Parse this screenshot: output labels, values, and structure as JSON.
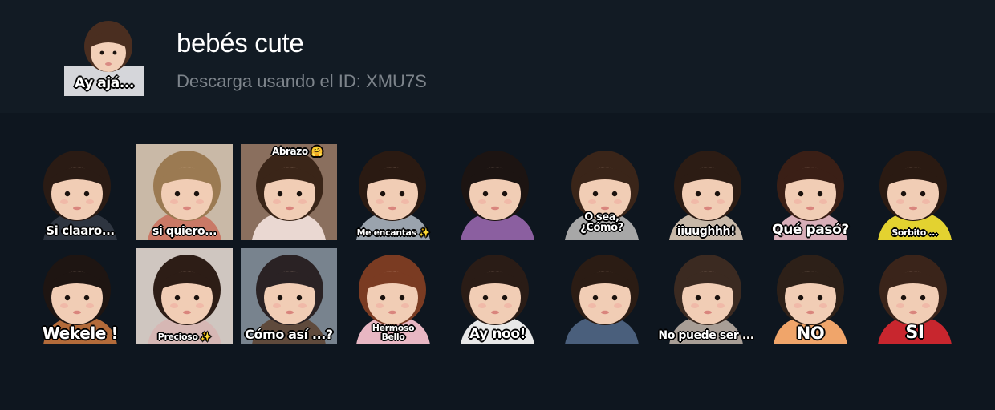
{
  "pack": {
    "title": "bebés cute",
    "subtitle": "Descarga usando el ID: XMU7S",
    "cover_caption": "Ay ajá...",
    "cover_bg": "#d9d9dc"
  },
  "stickers": [
    {
      "caption": "Si claaro...",
      "bg": "#0e161f",
      "hair": "#2a1b14",
      "shirt": "#2e3540"
    },
    {
      "caption": "si quiero...",
      "bg": "#c9b9a7",
      "hair": "#9b7a52",
      "shirt": "#c97966"
    },
    {
      "caption": "Abrazo 🤗",
      "bg": "#8a6f5e",
      "hair": "#3a2518",
      "shirt": "#ead8d2"
    },
    {
      "caption": "Me encantas ✨",
      "bg": "#0e161f",
      "hair": "#2a1a12",
      "shirt": "#9aa3ad"
    },
    {
      "caption": "",
      "bg": "#0e161f",
      "hair": "#1c1412",
      "shirt": "#8b5fa0"
    },
    {
      "caption": "O sea,\n¿Cómo?",
      "bg": "#0e161f",
      "hair": "#3a2519",
      "shirt": "#a7a7a7"
    },
    {
      "caption": "iiuughhh!",
      "bg": "#0e161f",
      "hair": "#2c1c14",
      "shirt": "#c7b8a8"
    },
    {
      "caption": "Qué pasó?",
      "bg": "#0e161f",
      "hair": "#3a1f16",
      "shirt": "#d8aeb8"
    },
    {
      "caption": "Sorbito ...",
      "bg": "#0e161f",
      "hair": "#2a1a12",
      "shirt": "#e3d230"
    },
    {
      "caption": "Wekele !",
      "bg": "#0e161f",
      "hair": "#1e1512",
      "shirt": "#b36b3a"
    },
    {
      "caption": "Precioso ✨",
      "bg": "#cfc6c0",
      "hair": "#2d1d16",
      "shirt": "#d6b7b4"
    },
    {
      "caption": "Cómo así ...?",
      "bg": "#78838e",
      "hair": "#2a2224",
      "shirt": "#5f4a3c"
    },
    {
      "caption": "Hermoso\nBello",
      "bg": "#0e161f",
      "hair": "#7a3b22",
      "shirt": "#e8b7c3"
    },
    {
      "caption": "Ay noo!",
      "bg": "#0e161f",
      "hair": "#2a1c16",
      "shirt": "#e8e8e8"
    },
    {
      "caption": "",
      "bg": "#0e161f",
      "hair": "#2b1c14",
      "shirt": "#4a5f7c"
    },
    {
      "caption": "No puede ser ...",
      "bg": "#0e161f",
      "hair": "#3b2a21",
      "shirt": "#a89e96"
    },
    {
      "caption": "NO",
      "bg": "#0e161f",
      "hair": "#2d2018",
      "shirt": "#f0a56a"
    },
    {
      "caption": "SI",
      "bg": "#0e161f",
      "hair": "#3a241a",
      "shirt": "#c8262e"
    }
  ]
}
